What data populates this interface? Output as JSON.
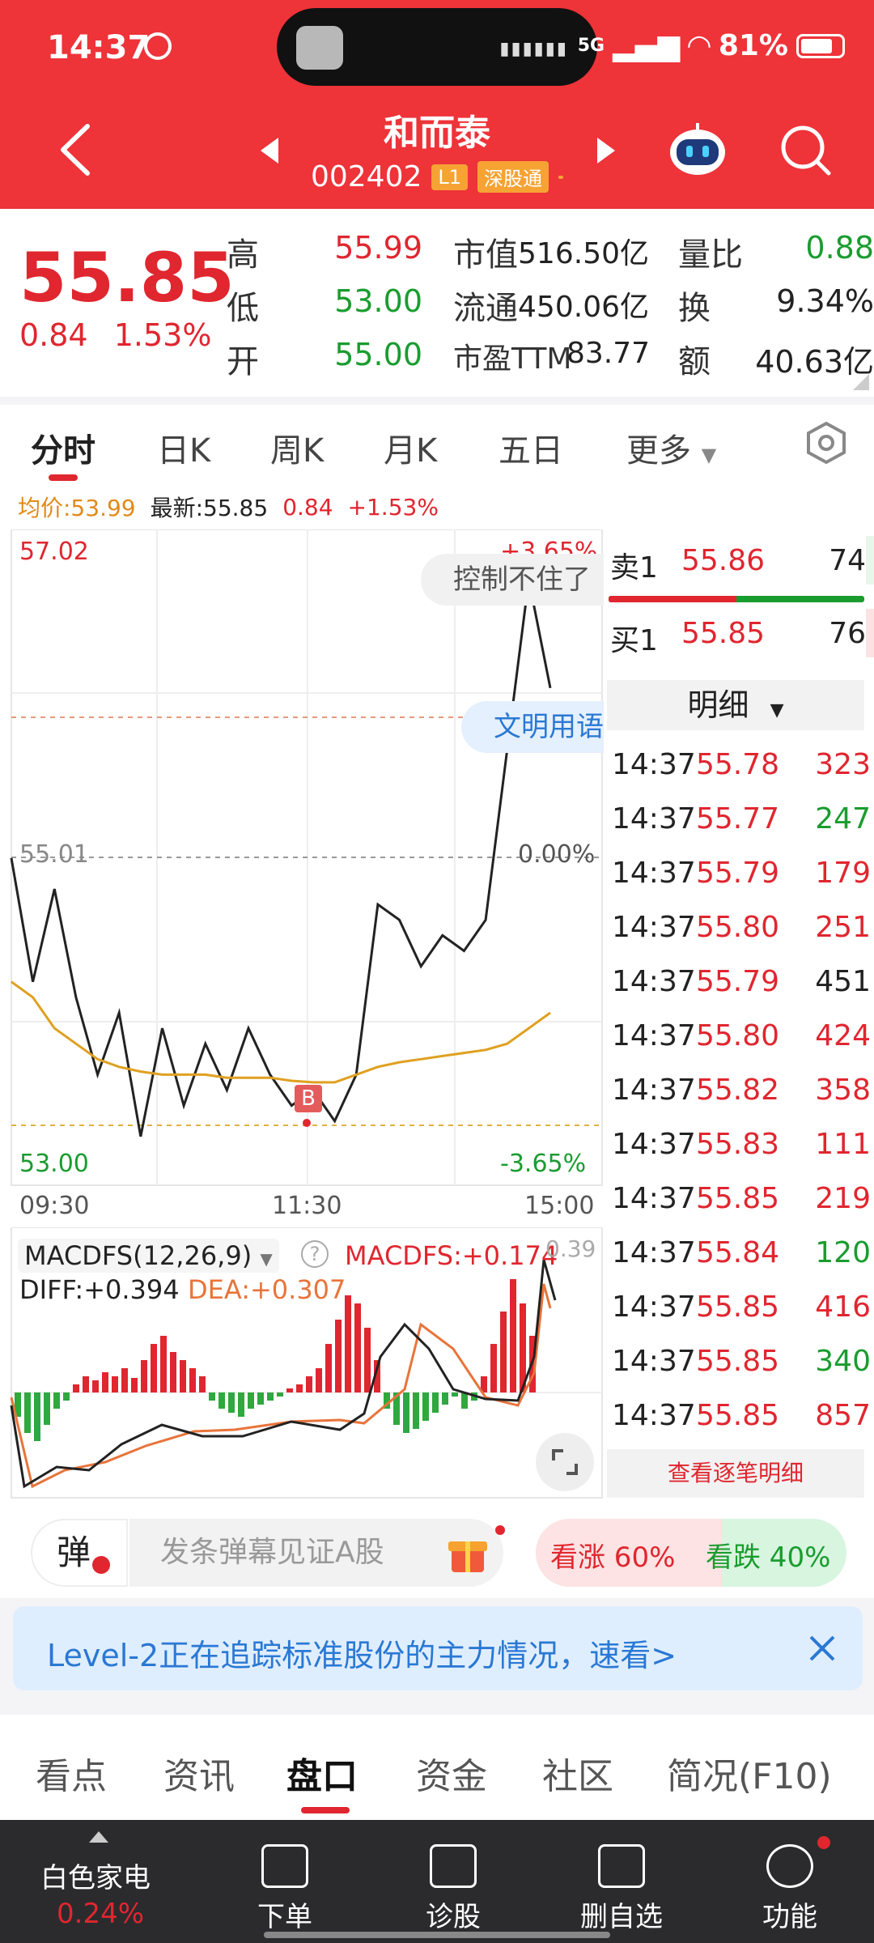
{
  "status_bar": {
    "time": "14:37",
    "network": "5G",
    "battery": "81%"
  },
  "header": {
    "stock_name": "和而泰",
    "stock_code": "002402",
    "level_tag": "L1",
    "connect_tag": "深股通"
  },
  "quote": {
    "price": "55.85",
    "change": "0.84",
    "change_pct": "1.53%",
    "high_label": "高",
    "high": "55.99",
    "low_label": "低",
    "low": "53.00",
    "open_label": "开",
    "open": "55.00",
    "mcap_label": "市值",
    "mcap": "516.50亿",
    "float_label": "流通",
    "float": "450.06亿",
    "pe_label": "市盈TTM",
    "pe": "83.77",
    "vr_label": "量比",
    "vr": "0.88",
    "turn_label": "换",
    "turn": "9.34%",
    "amt_label": "额",
    "amt": "40.63亿"
  },
  "chart_tabs": [
    "分时",
    "日K",
    "周K",
    "月K",
    "五日",
    "更多"
  ],
  "legend": {
    "avg": "均价:53.99",
    "latest": "最新:55.85",
    "chg": "0.84",
    "pct": "+1.53%"
  },
  "chart": {
    "y_top": "57.02",
    "y_mid": "55.01",
    "y_bot": "53.00",
    "pct_top": "+3.65%",
    "pct_mid": "0.00%",
    "pct_bot": "-3.65%",
    "x_labels": [
      "09:30",
      "11:30",
      "15:00"
    ],
    "bubble1": "控制不住了",
    "bubble2": "文明用语",
    "marker": "B"
  },
  "macd": {
    "title": "MACDFS(12,26,9)",
    "value": "MACDFS:+0.174",
    "diff": "DIFF:+0.394",
    "dea": "DEA:+0.307",
    "corner": "0.39"
  },
  "chart_data": {
    "type": "line",
    "xlabel": "",
    "ylabel": "",
    "ylim": [
      53.0,
      57.02
    ],
    "series": [
      {
        "name": "最新",
        "values": [
          55.0,
          54.2,
          54.8,
          54.1,
          53.6,
          54.0,
          53.2,
          53.9,
          53.4,
          53.8,
          53.5,
          53.9,
          53.6,
          53.4,
          53.5,
          53.3,
          53.6,
          54.7,
          54.6,
          54.3,
          54.5,
          54.4,
          54.6,
          55.7,
          56.8,
          56.1
        ]
      },
      {
        "name": "均价",
        "values": [
          54.2,
          54.1,
          53.9,
          53.8,
          53.7,
          53.65,
          53.62,
          53.6,
          53.6,
          53.6,
          53.58,
          53.58,
          53.58,
          53.56,
          53.55,
          53.55,
          53.6,
          53.65,
          53.68,
          53.7,
          53.72,
          53.74,
          53.76,
          53.8,
          53.9,
          54.0
        ]
      }
    ]
  },
  "order_book": {
    "sell_label": "卖1",
    "sell_price": "55.86",
    "sell_vol": "74",
    "buy_label": "买1",
    "buy_price": "55.85",
    "buy_vol": "76",
    "buy_ratio": 0.5
  },
  "detail": {
    "title": "明细",
    "rows": [
      {
        "time": "14:37",
        "price": "55.78",
        "vol": "323",
        "color": "red"
      },
      {
        "time": "14:37",
        "price": "55.77",
        "vol": "247",
        "color": "green"
      },
      {
        "time": "14:37",
        "price": "55.79",
        "vol": "179",
        "color": "red"
      },
      {
        "time": "14:37",
        "price": "55.80",
        "vol": "251",
        "color": "red"
      },
      {
        "time": "14:37",
        "price": "55.79",
        "vol": "451",
        "color": "black"
      },
      {
        "time": "14:37",
        "price": "55.80",
        "vol": "424",
        "color": "red"
      },
      {
        "time": "14:37",
        "price": "55.82",
        "vol": "358",
        "color": "red"
      },
      {
        "time": "14:37",
        "price": "55.83",
        "vol": "111",
        "color": "red"
      },
      {
        "time": "14:37",
        "price": "55.85",
        "vol": "219",
        "color": "red"
      },
      {
        "time": "14:37",
        "price": "55.84",
        "vol": "120",
        "color": "green"
      },
      {
        "time": "14:37",
        "price": "55.85",
        "vol": "416",
        "color": "red"
      },
      {
        "time": "14:37",
        "price": "55.85",
        "vol": "340",
        "color": "green"
      },
      {
        "time": "14:37",
        "price": "55.85",
        "vol": "857",
        "color": "red"
      }
    ],
    "more": "查看逐笔明细"
  },
  "danmaku": {
    "icon_label": "弹",
    "placeholder": "发条弹幕见证A股",
    "up": "看涨 60%",
    "down": "看跌 40%",
    "up_ratio": 0.6
  },
  "banner": {
    "text": "Level-2正在追踪标准股份的主力情况，速看>"
  },
  "bottom_tabs": [
    "看点",
    "资讯",
    "盘口",
    "资金",
    "社区",
    "简况(F10)"
  ],
  "bottom_nav": {
    "sector": "白色家电",
    "sector_pct": "0.24%",
    "items": [
      "下单",
      "诊股",
      "删自选",
      "功能"
    ]
  }
}
